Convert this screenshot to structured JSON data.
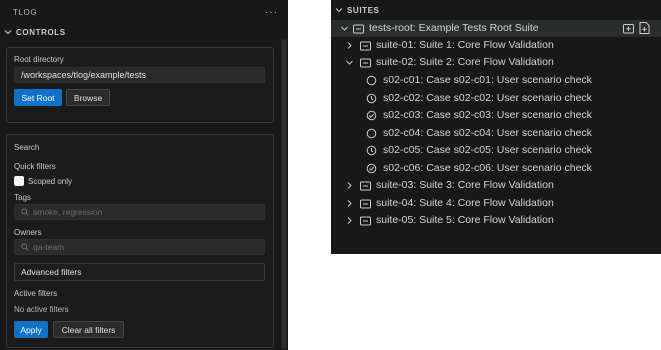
{
  "left_panel": {
    "title": "TLOG",
    "more_label": "···",
    "controls_label": "CONTROLS",
    "root_directory": {
      "label": "Root directory",
      "value": "/workspaces/tlog/example/tests",
      "set_root_label": "Set Root",
      "browse_label": "Browse"
    },
    "search": {
      "heading": "Search",
      "quick_filters_label": "Quick filters",
      "scoped_only_label": "Scoped only",
      "tags_label": "Tags",
      "tags_placeholder": "smoke, regression",
      "owners_label": "Owners",
      "owners_placeholder": "qa-team",
      "advanced_filters_label": "Advanced filters",
      "active_filters_label": "Active filters",
      "no_active_filters_label": "No active filters",
      "apply_label": "Apply",
      "clear_all_label": "Clear all filters"
    }
  },
  "suites_panel": {
    "title": "SUITES",
    "root": "tests-root: Example Tests Root Suite",
    "items": [
      {
        "label": "suite-01: Suite 1: Core Flow Validation",
        "expanded": false
      },
      {
        "label": "suite-02: Suite 2: Core Flow Validation",
        "expanded": true
      },
      {
        "label": "s02-c01: Case s02-c01: User scenario check",
        "status": "todo"
      },
      {
        "label": "s02-c02: Case s02-c02: User scenario check",
        "status": "in-progress"
      },
      {
        "label": "s02-c03: Case s02-c03: User scenario check",
        "status": "done"
      },
      {
        "label": "s02-c04: Case s02-c04: User scenario check",
        "status": "todo"
      },
      {
        "label": "s02-c05: Case s02-c05: User scenario check",
        "status": "in-progress"
      },
      {
        "label": "s02-c06: Case s02-c06: User scenario check",
        "status": "done"
      },
      {
        "label": "suite-03: Suite 3: Core Flow Validation",
        "expanded": false
      },
      {
        "label": "suite-04: Suite 4: Core Flow Validation",
        "expanded": false
      },
      {
        "label": "suite-05: Suite 5: Core Flow Validation",
        "expanded": false
      }
    ]
  },
  "icons": {
    "more": "ellipsis-icon",
    "section_toggle": "chevron-down-icon",
    "search": "search-icon",
    "suite": "folder-icon",
    "todo": "circle-icon",
    "in_progress": "clock-icon",
    "done": "check-circle-icon",
    "new_suite": "new-folder-icon",
    "new_case": "new-file-icon"
  },
  "colors": {
    "accent": "#0e73c7",
    "panel_bg": "#181818",
    "selected_row": "#2a2d2e"
  }
}
